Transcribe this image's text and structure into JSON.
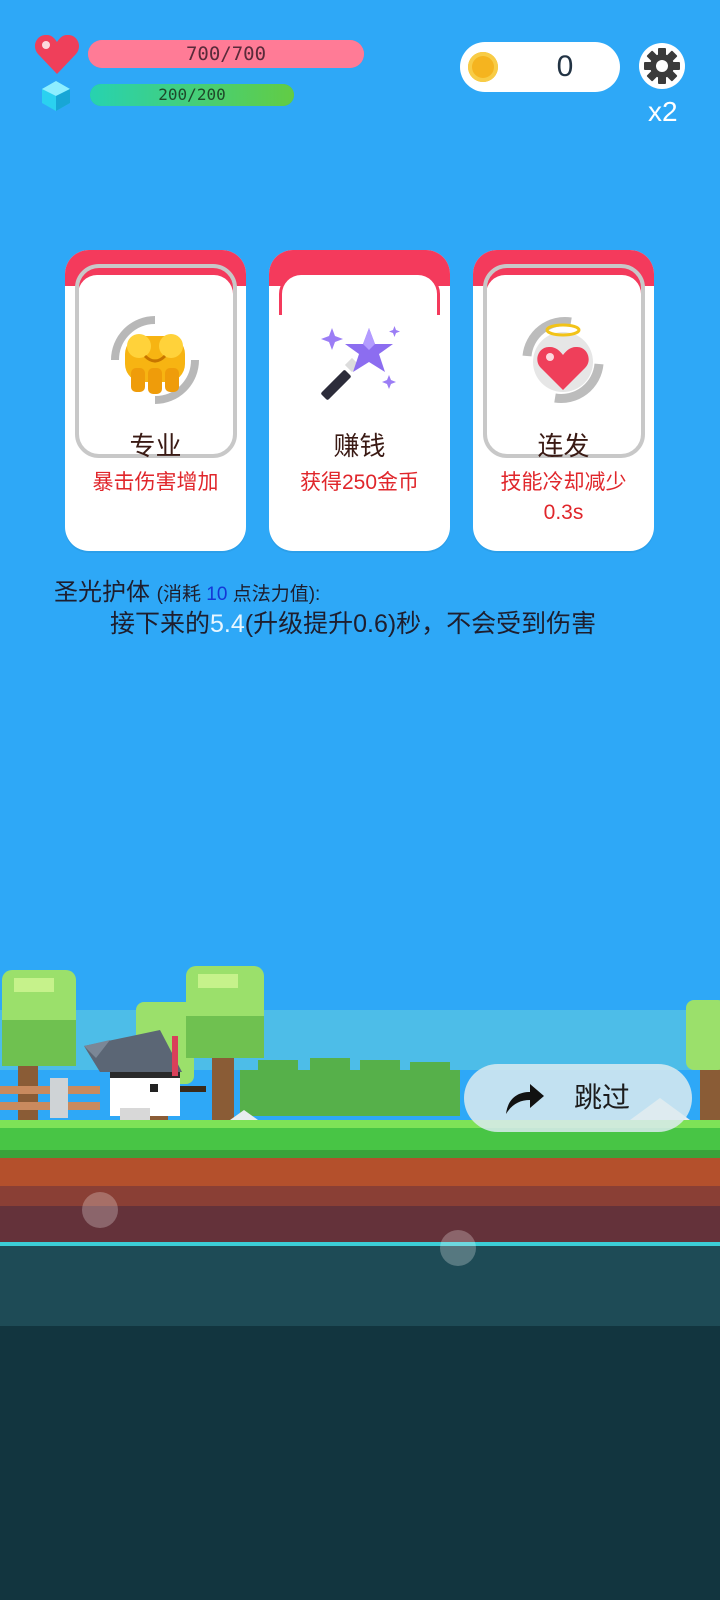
{
  "hud": {
    "hp": {
      "text": "700/700",
      "fraction": 1.0
    },
    "mp": {
      "text": "200/200",
      "fraction": 1.0
    },
    "coins": "0",
    "speed": "x2",
    "icons": [
      "heart-icon",
      "crystal-icon",
      "coin-icon",
      "gear-icon"
    ]
  },
  "cards": [
    {
      "title": "专业",
      "desc": "暴击伤害增加",
      "icon": "golden-fist-icon"
    },
    {
      "title": "赚钱",
      "desc": "获得250金币",
      "icon": "magic-wand-icon"
    },
    {
      "title": "连发",
      "desc": "技能冷却减少",
      "desc2": "0.3s",
      "icon": "angel-heart-icon"
    }
  ],
  "skill": {
    "name": "圣光护体",
    "cost_prefix": "(消耗 ",
    "cost_value": "10",
    "cost_suffix": " 点法力值):",
    "desc_prefix": "接下来的",
    "desc_value": "5.4",
    "desc_suffix": "(升级提升0.6)秒，不会受到伤害"
  },
  "skip_button": {
    "label": "跳过",
    "icon": "redo-arrow-icon"
  },
  "colors": {
    "sky": "#2ea8f7",
    "hp_bar": "#ff7b96",
    "mp_bar_start": "#27d2b0",
    "mp_bar_end": "#62cc44",
    "card_header": "#f43a5c",
    "desc_red": "#e0262b",
    "grass": "#48c545",
    "dirt": "#b4502c",
    "water": "#15404a"
  }
}
